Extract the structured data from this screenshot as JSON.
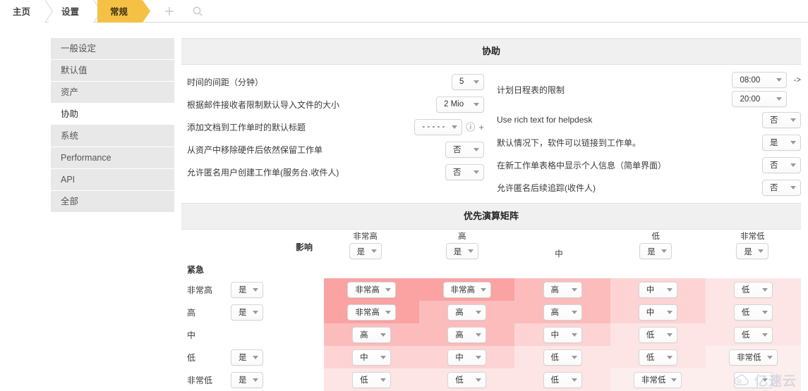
{
  "topbar": {
    "crumbs": [
      {
        "label": "主页",
        "active": false
      },
      {
        "label": "设置",
        "active": false
      },
      {
        "label": "常规",
        "active": true
      }
    ],
    "add_icon": "plus-icon",
    "search_icon": "search-icon"
  },
  "sidebar": {
    "items": [
      {
        "label": "一般设定",
        "active": false
      },
      {
        "label": "默认值",
        "active": false
      },
      {
        "label": "资产",
        "active": false
      },
      {
        "label": "协助",
        "active": true
      },
      {
        "label": "系统",
        "active": false
      },
      {
        "label": "Performance",
        "active": false
      },
      {
        "label": "API",
        "active": false
      },
      {
        "label": "全部",
        "active": false
      }
    ]
  },
  "helpdesk": {
    "title": "协助",
    "left_rows": [
      {
        "label": "时间的间距（分钟）",
        "value": "5",
        "width": "w-xs"
      },
      {
        "label": "根据邮件接收者限制默认导入文件的大小",
        "value": "2 Mio",
        "width": "w-m"
      },
      {
        "label": "添加文档到工作单时的默认标题",
        "value": "- - - - -",
        "width": "w-m",
        "info": "ⓘ",
        "plus": "+"
      },
      {
        "label": "从资产中移除硬件后依然保留工作单",
        "value": "否",
        "width": "w-s"
      },
      {
        "label": "允许匿名用户创建工作单(服务台.收件人)",
        "value": "否",
        "width": "w-s"
      }
    ],
    "right_rows": [
      {
        "label": "计划日程表的限制",
        "value": "08:00",
        "value2": "20:00",
        "arrow": "->",
        "width": "w-time"
      },
      {
        "label": "Use rich text for helpdesk",
        "value": "否",
        "width": "w-s"
      },
      {
        "label": "默认情况下，软件可以链接到工作单。",
        "value": "是",
        "width": "w-s"
      },
      {
        "label": "在新工作单表格中显示个人信息（简单界面）",
        "value": "否",
        "width": "w-s"
      },
      {
        "label": "允许匿名后续追踪(收件人)",
        "value": "否",
        "width": "w-s"
      }
    ]
  },
  "matrix": {
    "title": "优先演算矩阵",
    "impact_label": "影响",
    "urgency_label": "紧急",
    "columns": [
      {
        "header": "非常高",
        "enabled": "是",
        "has_select": true
      },
      {
        "header": "高",
        "enabled": "是",
        "has_select": true
      },
      {
        "header": "中",
        "enabled": "",
        "has_select": false
      },
      {
        "header": "低",
        "enabled": "是",
        "has_select": true
      },
      {
        "header": "非常低",
        "enabled": "是",
        "has_select": true
      }
    ],
    "rows": [
      {
        "label": "非常高",
        "enabled": "是",
        "has_select": true,
        "cells": [
          {
            "value": "非常高",
            "bg": "#fba2a2",
            "width": "w-m"
          },
          {
            "value": "非常高",
            "bg": "#fba2a2",
            "width": "w-m"
          },
          {
            "value": "高",
            "bg": "#fcbcbc",
            "width": "w-s"
          },
          {
            "value": "中",
            "bg": "#fdd3d3",
            "width": "w-s"
          },
          {
            "value": "低",
            "bg": "#fde5e5",
            "width": "w-s"
          }
        ]
      },
      {
        "label": "高",
        "enabled": "是",
        "has_select": true,
        "cells": [
          {
            "value": "非常高",
            "bg": "#fba2a2",
            "width": "w-m"
          },
          {
            "value": "高",
            "bg": "#fcbcbc",
            "width": "w-s"
          },
          {
            "value": "高",
            "bg": "#fcbcbc",
            "width": "w-s"
          },
          {
            "value": "中",
            "bg": "#fdd3d3",
            "width": "w-s"
          },
          {
            "value": "低",
            "bg": "#fde5e5",
            "width": "w-s"
          }
        ]
      },
      {
        "label": "中",
        "enabled": "",
        "has_select": false,
        "cells": [
          {
            "value": "高",
            "bg": "#fcbcbc",
            "width": "w-s"
          },
          {
            "value": "高",
            "bg": "#fcbcbc",
            "width": "w-s"
          },
          {
            "value": "中",
            "bg": "#fdd3d3",
            "width": "w-s"
          },
          {
            "value": "低",
            "bg": "#fde5e5",
            "width": "w-s"
          },
          {
            "value": "低",
            "bg": "#fde5e5",
            "width": "w-s"
          }
        ]
      },
      {
        "label": "低",
        "enabled": "是",
        "has_select": true,
        "cells": [
          {
            "value": "中",
            "bg": "#fdd3d3",
            "width": "w-s"
          },
          {
            "value": "中",
            "bg": "#fdd3d3",
            "width": "w-s"
          },
          {
            "value": "低",
            "bg": "#fde5e5",
            "width": "w-s"
          },
          {
            "value": "低",
            "bg": "#fde5e5",
            "width": "w-s"
          },
          {
            "value": "非常低",
            "bg": "#fdeeee",
            "width": "w-m"
          }
        ]
      },
      {
        "label": "非常低",
        "enabled": "是",
        "has_select": true,
        "cells": [
          {
            "value": "低",
            "bg": "#fde5e5",
            "width": "w-s"
          },
          {
            "value": "低",
            "bg": "#fde5e5",
            "width": "w-s"
          },
          {
            "value": "低",
            "bg": "#fde5e5",
            "width": "w-s"
          },
          {
            "value": "非常低",
            "bg": "#fdeeee",
            "width": "w-m"
          },
          {
            "value": "",
            "bg": "#fdeeee",
            "width": "w-s"
          }
        ]
      }
    ]
  },
  "watermark": {
    "text": "亿速云",
    "icon": "cloud-icon"
  }
}
